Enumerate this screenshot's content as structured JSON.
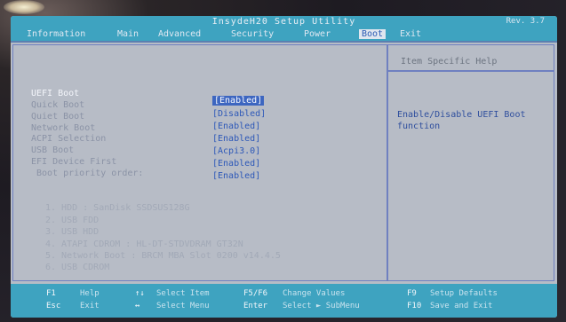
{
  "window": {
    "title": "InsydeH20 Setup Utility",
    "version": "Rev. 3.7"
  },
  "tabs": [
    {
      "label": "Information"
    },
    {
      "label": "Main"
    },
    {
      "label": "Advanced"
    },
    {
      "label": "Security"
    },
    {
      "label": "Power"
    },
    {
      "label": "Boot"
    },
    {
      "label": "Exit"
    }
  ],
  "settings": [
    {
      "label": "UEFI Boot",
      "value": "[Enabled]"
    },
    {
      "label": "Quick Boot",
      "value": "[Disabled]"
    },
    {
      "label": "Quiet Boot",
      "value": "[Enabled]"
    },
    {
      "label": "Network Boot",
      "value": "[Enabled]"
    },
    {
      "label": "ACPI Selection",
      "value": "[Acpi3.0]"
    },
    {
      "label": "USB Boot",
      "value": "[Enabled]"
    },
    {
      "label": "EFI Device First",
      "value": "[Enabled]"
    },
    {
      "label": "Boot priority order:"
    }
  ],
  "boot_order": [
    "1. HDD : SanDisk SSDSUS128G",
    "2. USB FDD",
    "3. USB HDD",
    "4. ATAPI CDROM : HL-DT-STDVDRAM GT32N",
    "5. Network Boot : BRCM MBA Slot 0200 v14.4.5",
    "6. USB CDROM"
  ],
  "help": {
    "title": "Item Specific Help",
    "text": "Enable/Disable UEFI Boot function"
  },
  "footer": {
    "col1": [
      "F1",
      "Help",
      "Esc",
      "Exit"
    ],
    "col2": [
      "↑↓",
      "Select Item",
      "↔",
      "Select Menu"
    ],
    "col3": [
      "F5/F6",
      "Change Values",
      "Enter",
      "Select ► SubMenu"
    ],
    "col4": [
      "F9",
      "Setup Defaults",
      "F10",
      "Save and Exit"
    ]
  },
  "colors": {
    "bar": "#3ea3c0",
    "panel": "#b7bcc6",
    "value_text": "#2d58b8",
    "highlight": "#3d66c0"
  }
}
